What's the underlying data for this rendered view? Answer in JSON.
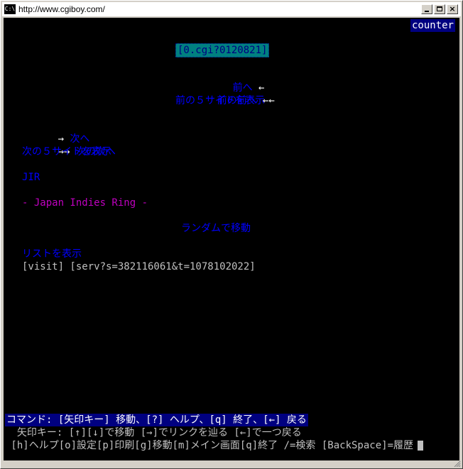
{
  "window": {
    "icon_label": "C:\\",
    "title": "http://www.cgiboy.com/"
  },
  "terminal": {
    "counter": "counter",
    "cgi_link": "[0.cgi?0120821]",
    "prev": {
      "label": "前へ",
      "arrow": " ←"
    },
    "prev2": {
      "label": "前の前へ",
      "arrow": " ←←"
    },
    "prev5": "前の５サイトを表示",
    "next": {
      "arrow": "→ ",
      "label": "次へ"
    },
    "next2": {
      "arrow": "→→ ",
      "label": "次の次へ"
    },
    "next5": "次の５サイトを表示",
    "jir": "JIR",
    "ring_name": "- Japan Indies Ring -",
    "random": "ランダムで移動",
    "list": "リストを表示",
    "visit": "[visit] [serv?s=382116061&t=1078102022]",
    "command_bar": "コマンド: [矢印キー] 移動、[?] ヘルプ、[q] 終了、[←] 戻る",
    "help_line_1": "  矢印キー: [↑][↓]で移動 [→]でリンクを辿る [←]で一つ戻る",
    "help_line_2": " [h]ヘルプ[o]設定[p]印刷[g]移動[m]メイン画面[q]終了 /=検索 [BackSpace]=履歴"
  },
  "colors": {
    "link": "#0000ff",
    "background": "#000000",
    "highlight_bar": "#000080",
    "cgi_highlight": "#008080",
    "magenta_text": "#c000c0"
  }
}
